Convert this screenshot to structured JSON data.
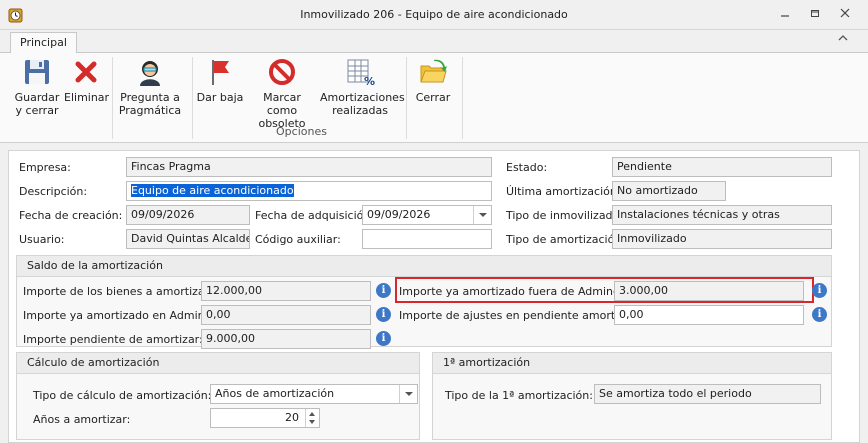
{
  "window": {
    "title": "Inmovilizado 206 - Equipo de aire acondicionado",
    "minimize_icon": "minimize-icon",
    "restore_icon": "restore-icon",
    "close_icon": "close-icon"
  },
  "tabs": {
    "principal": "Principal"
  },
  "ribbon": {
    "save_close": "Guardar\ny cerrar",
    "delete": "Eliminar",
    "ask": "Pregunta a\nPragmática",
    "dar_baja": "Dar baja",
    "obsolete": "Marcar como\nobsoleto",
    "amortizations": "Amortizaciones\nrealizadas",
    "close": "Cerrar",
    "options_group": "Opciones"
  },
  "form": {
    "empresa_label": "Empresa:",
    "empresa_value": "Fincas Pragma",
    "descripcion_label": "Descripción:",
    "descripcion_value": "Equipo de aire acondicionado",
    "fecha_creacion_label": "Fecha de creación:",
    "fecha_creacion_value": "09/09/2026",
    "fecha_adquisicion_label": "Fecha de adquisición:",
    "fecha_adquisicion_value": "09/09/2026",
    "usuario_label": "Usuario:",
    "usuario_value": "David Quintas Alcalde",
    "codigo_label": "Código auxiliar:",
    "codigo_value": "",
    "estado_label": "Estado:",
    "estado_value": "Pendiente",
    "ultima_label": "Última amortización:",
    "ultima_value": "No amortizado",
    "tipo_inmov_label": "Tipo de inmovilizado:",
    "tipo_inmov_value": "Instalaciones técnicas y otras",
    "tipo_amort_label": "Tipo de amortización:",
    "tipo_amort_value": "Inmovilizado"
  },
  "saldo": {
    "header": "Saldo de la amortización",
    "importe_bienes_label": "Importe de los bienes a amortizar:",
    "importe_bienes_value": "12.000,00",
    "ya_adminet_label": "Importe ya amortizado en Adminet:",
    "ya_adminet_value": "0,00",
    "pendiente_label": "Importe pendiente de amortizar:",
    "pendiente_value": "9.000,00",
    "fuera_label": "Importe ya amortizado fuera de Adminet:",
    "fuera_value": "3.000,00",
    "ajustes_label": "Importe de ajustes en pendiente amortizar:",
    "ajustes_value": "0,00"
  },
  "calculo": {
    "header": "Cálculo de amortización",
    "tipo_label": "Tipo de cálculo de amortización:",
    "tipo_value": "Años de amortización",
    "anios_label": "Años a amortizar:",
    "anios_value": "20"
  },
  "primera": {
    "header": "1ª amortización",
    "tipo_label": "Tipo de la 1ª amortización:",
    "tipo_value": "Se amortiza todo el periodo"
  },
  "colors": {
    "accent": "#0a64d8",
    "highlight": "#d8262a",
    "info": "#3d78c8"
  }
}
